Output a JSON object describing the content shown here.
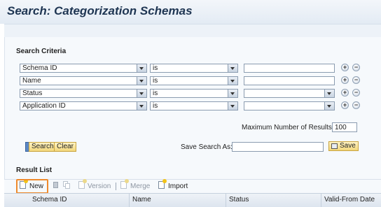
{
  "page": {
    "title": "Search: Categorization Schemas"
  },
  "search_criteria": {
    "title": "Search Criteria",
    "rows": [
      {
        "field": "Schema ID",
        "operator": "is",
        "value": "",
        "value_is_dropdown": false
      },
      {
        "field": "Name",
        "operator": "is",
        "value": "",
        "value_is_dropdown": false
      },
      {
        "field": "Status",
        "operator": "is",
        "value": "",
        "value_is_dropdown": true
      },
      {
        "field": "Application ID",
        "operator": "is",
        "value": "",
        "value_is_dropdown": true
      }
    ],
    "add_icon": "plus-circle-icon",
    "remove_icon": "minus-circle-icon",
    "max_results_label": "Maximum Number of Results:",
    "max_results_value": "100"
  },
  "actions": {
    "search_label": "Search",
    "clear_label": "Clear",
    "save_search_label": "Save Search As:",
    "save_search_value": "",
    "save_label": "Save"
  },
  "result_list": {
    "title": "Result List",
    "toolbar": {
      "new_label": "New",
      "version_label": "Version",
      "merge_label": "Merge",
      "import_label": "Import"
    },
    "columns": [
      "Schema ID",
      "Name",
      "Status",
      "Valid-From Date"
    ]
  },
  "colors": {
    "title": "#1e3552",
    "highlight": "#ef8a2c",
    "button_yellow": "#f2d77b",
    "panel": "#f6f9fc"
  }
}
